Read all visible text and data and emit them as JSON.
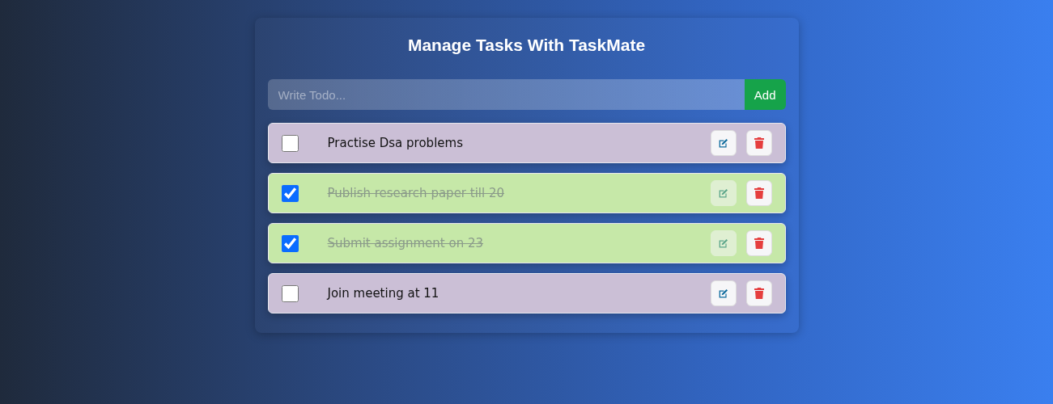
{
  "title": "Manage Tasks With TaskMate",
  "new_todo": {
    "placeholder": "Write Todo...",
    "button": "Add"
  },
  "todos": [
    {
      "text": "Practise Dsa problems",
      "completed": false
    },
    {
      "text": "Publish research paper till 20 ",
      "completed": true
    },
    {
      "text": "Submit assignment on 23",
      "completed": true
    },
    {
      "text": "Join meeting at 11",
      "completed": false
    }
  ]
}
